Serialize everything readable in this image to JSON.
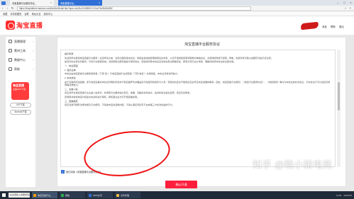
{
  "browser": {
    "window_title": "",
    "tabs": [
      {
        "label": "淘宝直播平台服务协议_",
        "active": false
      },
      {
        "label": "淘宝直播平台_",
        "active": true
      }
    ],
    "url": "https://liveplatform.taobao.com/live/liveDetail.htm?spm=a1z9u.8142865.0.0.6c47be3bWpRkE",
    "bookmarks": [
      "收藏",
      "手机收藏夹",
      "谷歌",
      "网址大全",
      "游戏中心"
    ]
  },
  "header": {
    "logo_text": "淘宝直播",
    "links": [
      "消息",
      "帮助",
      "退出"
    ]
  },
  "sidebar": {
    "items": [
      {
        "label": "直播管理",
        "icon": "monitor-icon"
      },
      {
        "label": "素材工具",
        "icon": "box-icon"
      },
      {
        "label": "数据中心",
        "icon": "chart-icon"
      },
      {
        "label": "帮助",
        "icon": "help-icon"
      }
    ],
    "promo_title": "淘宝直播",
    "promo_sub": "主播APP下载",
    "download_buttons": [
      "iOS下载",
      "Android下载"
    ]
  },
  "agreement": {
    "title": "淘宝直播平台服务协议",
    "paragraphs": [
      "提示条款",
      "欢迎您申请使用淘宝直播平台服务！在您申请之前，请您仔细阅读本协议，特别是免除或者限制责任的条款，以及开通或使用某项服务的单独协议，并选择接受或不接受。限制、免责条款可能以加粗形式提示您注意。",
      "如您对协议有任何疑问，可向平台客服咨询。当您按照注册页面提示填写信息、阅读并同意本协议且完成全部注册程序后，即表示您已充分阅读、理解并接受本协议的全部内容。",
      "一、协议范围",
      "1. 签约主体",
      "本协议由淘宝直播平台服务使用者（下称“您”）与淘宝直播平台经营者（下称“淘宝”）共同缔结，本协议具有合同效力。",
      "2. 补充协议",
      "由于互联网高速发展，您与淘宝签署的本协议列明的条款并不能完整罗列并覆盖您与淘宝所有权利与义务，现有的约定也不能保证完全符合未来发展的需求。因此，淘宝直播平台规则、《淘宝平台服务协议》、《淘宝规则》等均为本协议的补充协议，与本协议不可分割且具有同等法律效力。",
      "二、主播入驻",
      "您应当符合淘宝直播平台主播入驻条件，并按照平台要求提交真实、准确、完整的资料信息，如资料信息发生变更，您应及时更新。",
      "您同意并授权淘宝对您提交的资料进行审核，审核通过后方可开通直播权限。",
      "三、直播规范",
      "您应当遵守国家法律法规及平台规则，不得发布违法违规内容，不得从事任何损害平台或第三方合法权益的行为。"
    ],
    "checkbox_label": "我已阅读《淘宝直播平台服务协议》",
    "checkbox_checked": true,
    "button_label": "确认开通"
  },
  "watermark": "知乎 @晓小猪电商",
  "taskbar": {
    "search_placeholder": "在这里输入你要搜索的内容",
    "apps": [
      {
        "label": "淘宝直播平台_",
        "active": true
      },
      {
        "label": "微信",
        "active": false
      },
      {
        "label": "WPS文字",
        "active": false
      },
      {
        "label": "文件管理",
        "active": false
      }
    ],
    "time": "14:53",
    "date": "2019/1/5"
  }
}
